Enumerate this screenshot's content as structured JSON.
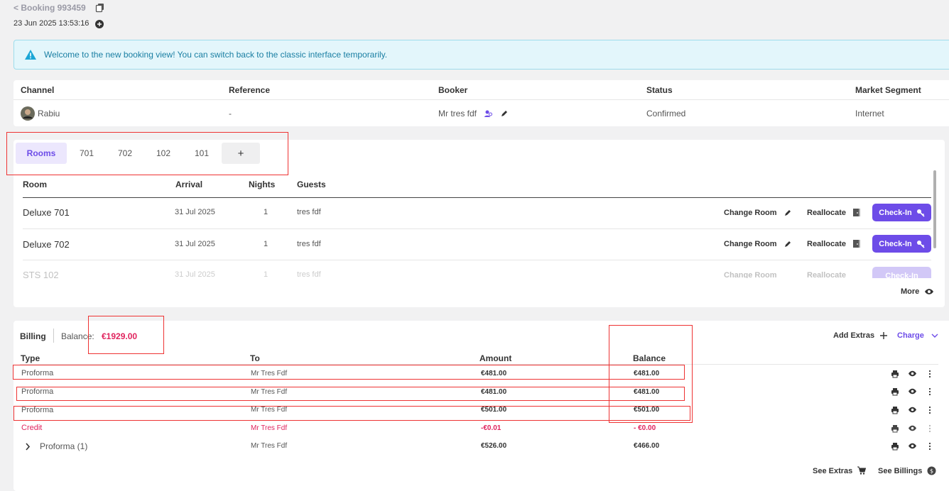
{
  "header": {
    "back_label": "< Booking 993459",
    "timestamp": "23 Jun 2025 13:53:16"
  },
  "notice": {
    "text": "Welcome to the new booking view! You can switch back to the classic interface temporarily."
  },
  "summary": {
    "columns": [
      "Channel",
      "Reference",
      "Booker",
      "Status",
      "Market Segment"
    ],
    "channel": "Rabiu",
    "reference": "-",
    "booker": "Mr tres fdf",
    "status": "Confirmed",
    "market_segment": "Internet"
  },
  "room_tabs": [
    "Rooms",
    "701",
    "702",
    "102",
    "101",
    "+"
  ],
  "rooms": {
    "columns": [
      "Room",
      "Arrival",
      "Nights",
      "Guests"
    ],
    "change_room_label": "Change Room",
    "reallocate_label": "Reallocate",
    "checkin_label": "Check-In",
    "rows": [
      {
        "room": "Deluxe 701",
        "arrival": "31 Jul 2025",
        "nights": "1",
        "guests": "tres fdf"
      },
      {
        "room": "Deluxe 702",
        "arrival": "31 Jul 2025",
        "nights": "1",
        "guests": "tres fdf"
      },
      {
        "room": "STS 102",
        "arrival": "31 Jul 2025",
        "nights": "1",
        "guests": "tres fdf"
      }
    ],
    "more_label": "More"
  },
  "billing": {
    "title": "Billing",
    "balance_label": "Balance:",
    "balance_value": "€1929.00",
    "add_extras_label": "Add Extras",
    "charge_label": "Charge",
    "columns": [
      "Type",
      "To",
      "Amount",
      "Balance"
    ],
    "rows": [
      {
        "type": "Proforma",
        "to": "Mr Tres Fdf",
        "amount": "€481.00",
        "balance": "€481.00"
      },
      {
        "type": "Proforma",
        "to": "Mr Tres Fdf",
        "amount": "€481.00",
        "balance": "€481.00"
      },
      {
        "type": "Proforma",
        "to": "Mr Tres Fdf",
        "amount": "€501.00",
        "balance": "€501.00"
      },
      {
        "type": "Credit",
        "to": "Mr Tres Fdf",
        "amount": "-€0.01",
        "balance": "- €0.00"
      },
      {
        "type": "Proforma (1)",
        "to": "Mr Tres Fdf",
        "amount": "€526.00",
        "balance": "€466.00"
      }
    ],
    "see_extras_label": "See Extras",
    "see_billings_label": "See Billings"
  },
  "colors": {
    "accent": "#6d4ce8",
    "credit_red": "#e0245e",
    "notice_bg": "#e3f6fb",
    "annotation_red": "#ee3333"
  }
}
